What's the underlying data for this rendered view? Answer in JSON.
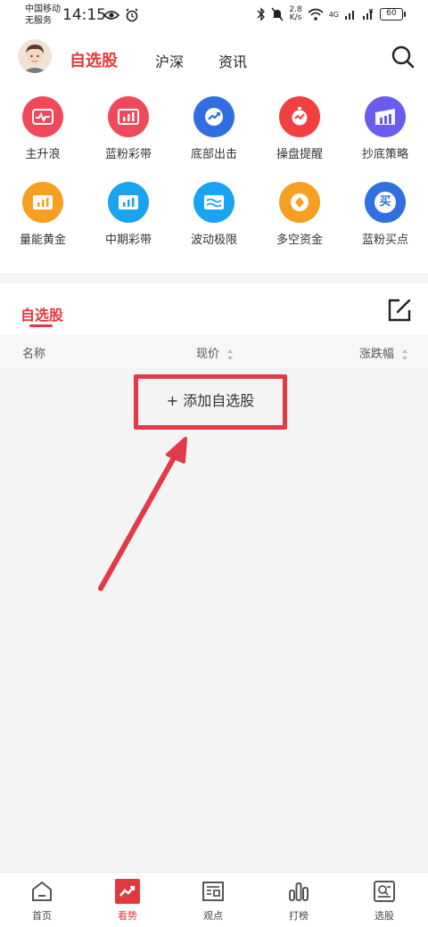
{
  "statusbar": {
    "carrier_line1": "中国移动",
    "carrier_line2": "无服务",
    "time": "14:15",
    "net_speed_value": "2.8",
    "net_speed_unit": "K/s",
    "network_type": "4G",
    "battery": "60"
  },
  "header": {
    "tab_watchlist": "自选股",
    "tab_market": "沪深",
    "tab_news": "资讯"
  },
  "features": [
    {
      "label": "主升浪",
      "color": "#f04a5a",
      "icon": "pulse-icon"
    },
    {
      "label": "蓝粉彩带",
      "color": "#f04a5a",
      "icon": "bar-chart-icon"
    },
    {
      "label": "底部出击",
      "color": "#2f6fe0",
      "icon": "trend-up-icon"
    },
    {
      "label": "操盘提醒",
      "color": "#f04040",
      "icon": "alarm-clock-icon"
    },
    {
      "label": "抄底策略",
      "color": "#6b5cf0",
      "icon": "strategy-chart-icon"
    },
    {
      "label": "量能黄金",
      "color": "#f5a020",
      "icon": "bar-chart-icon"
    },
    {
      "label": "中期彩带",
      "color": "#1aa3f0",
      "icon": "bar-chart-icon"
    },
    {
      "label": "波动极限",
      "color": "#1aa3f0",
      "icon": "wave-icon"
    },
    {
      "label": "多空资金",
      "color": "#f5a020",
      "icon": "coin-icon"
    },
    {
      "label": "蓝粉买点",
      "color": "#2f6fe0",
      "icon": "buy-icon",
      "glyph": "买"
    }
  ],
  "watchlist": {
    "title": "自选股",
    "columns": {
      "name": "名称",
      "price": "现价",
      "change": "涨跌幅"
    },
    "add_button": "+ 添加自选股"
  },
  "bottom_nav": [
    {
      "label": "首页",
      "icon": "home-icon",
      "active": false
    },
    {
      "label": "看势",
      "icon": "trend-icon",
      "active": true
    },
    {
      "label": "观点",
      "icon": "article-icon",
      "active": false
    },
    {
      "label": "打榜",
      "icon": "ranking-icon",
      "active": false
    },
    {
      "label": "选股",
      "icon": "stock-picker-icon",
      "active": false
    }
  ],
  "colors": {
    "accent": "#e4393c",
    "annotation": "#e23a48"
  }
}
